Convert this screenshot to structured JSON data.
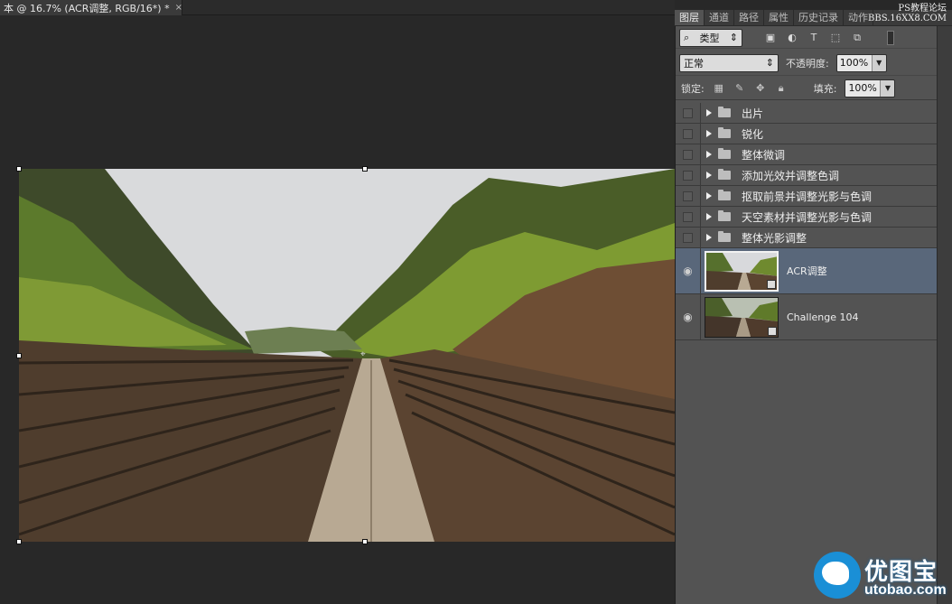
{
  "document": {
    "tab_title": "本 @ 16.7% (ACR调整, RGB/16*) *",
    "close_glyph": "×"
  },
  "panel": {
    "tabs": [
      "图层",
      "通道",
      "路径",
      "属性",
      "历史记录",
      "动作"
    ],
    "active_tab": "图层",
    "filter": {
      "kind_label": "类型",
      "icons": [
        "image-filter-icon",
        "adjustment-filter-icon",
        "type-filter-icon",
        "shape-filter-icon",
        "smart-object-filter-icon"
      ]
    },
    "blend": {
      "mode": "正常",
      "opacity_label": "不透明度:",
      "opacity_value": "100%"
    },
    "lock": {
      "label": "锁定:",
      "fill_label": "填充:",
      "fill_value": "100%"
    },
    "groups": [
      "出片",
      "锐化",
      "整体微调",
      "添加光效并调整色调",
      "抠取前景并调整光影与色调",
      "天空素材并调整光影与色调",
      "整体光影调整"
    ],
    "layers": [
      {
        "name": "ACR调整",
        "selected": true
      },
      {
        "name": "Challenge 104",
        "selected": false
      }
    ]
  },
  "watermarks": {
    "top_line1": "PS教程论坛",
    "top_line2": "BBS.16XX8.COM",
    "bottom_title": "优图宝",
    "bottom_url": "utobao.com"
  },
  "colors": {
    "canvas_bg": "#282828",
    "panel_bg": "#535353",
    "selected_layer": "#59677a",
    "watermark_blue": "#1a8fd6"
  }
}
